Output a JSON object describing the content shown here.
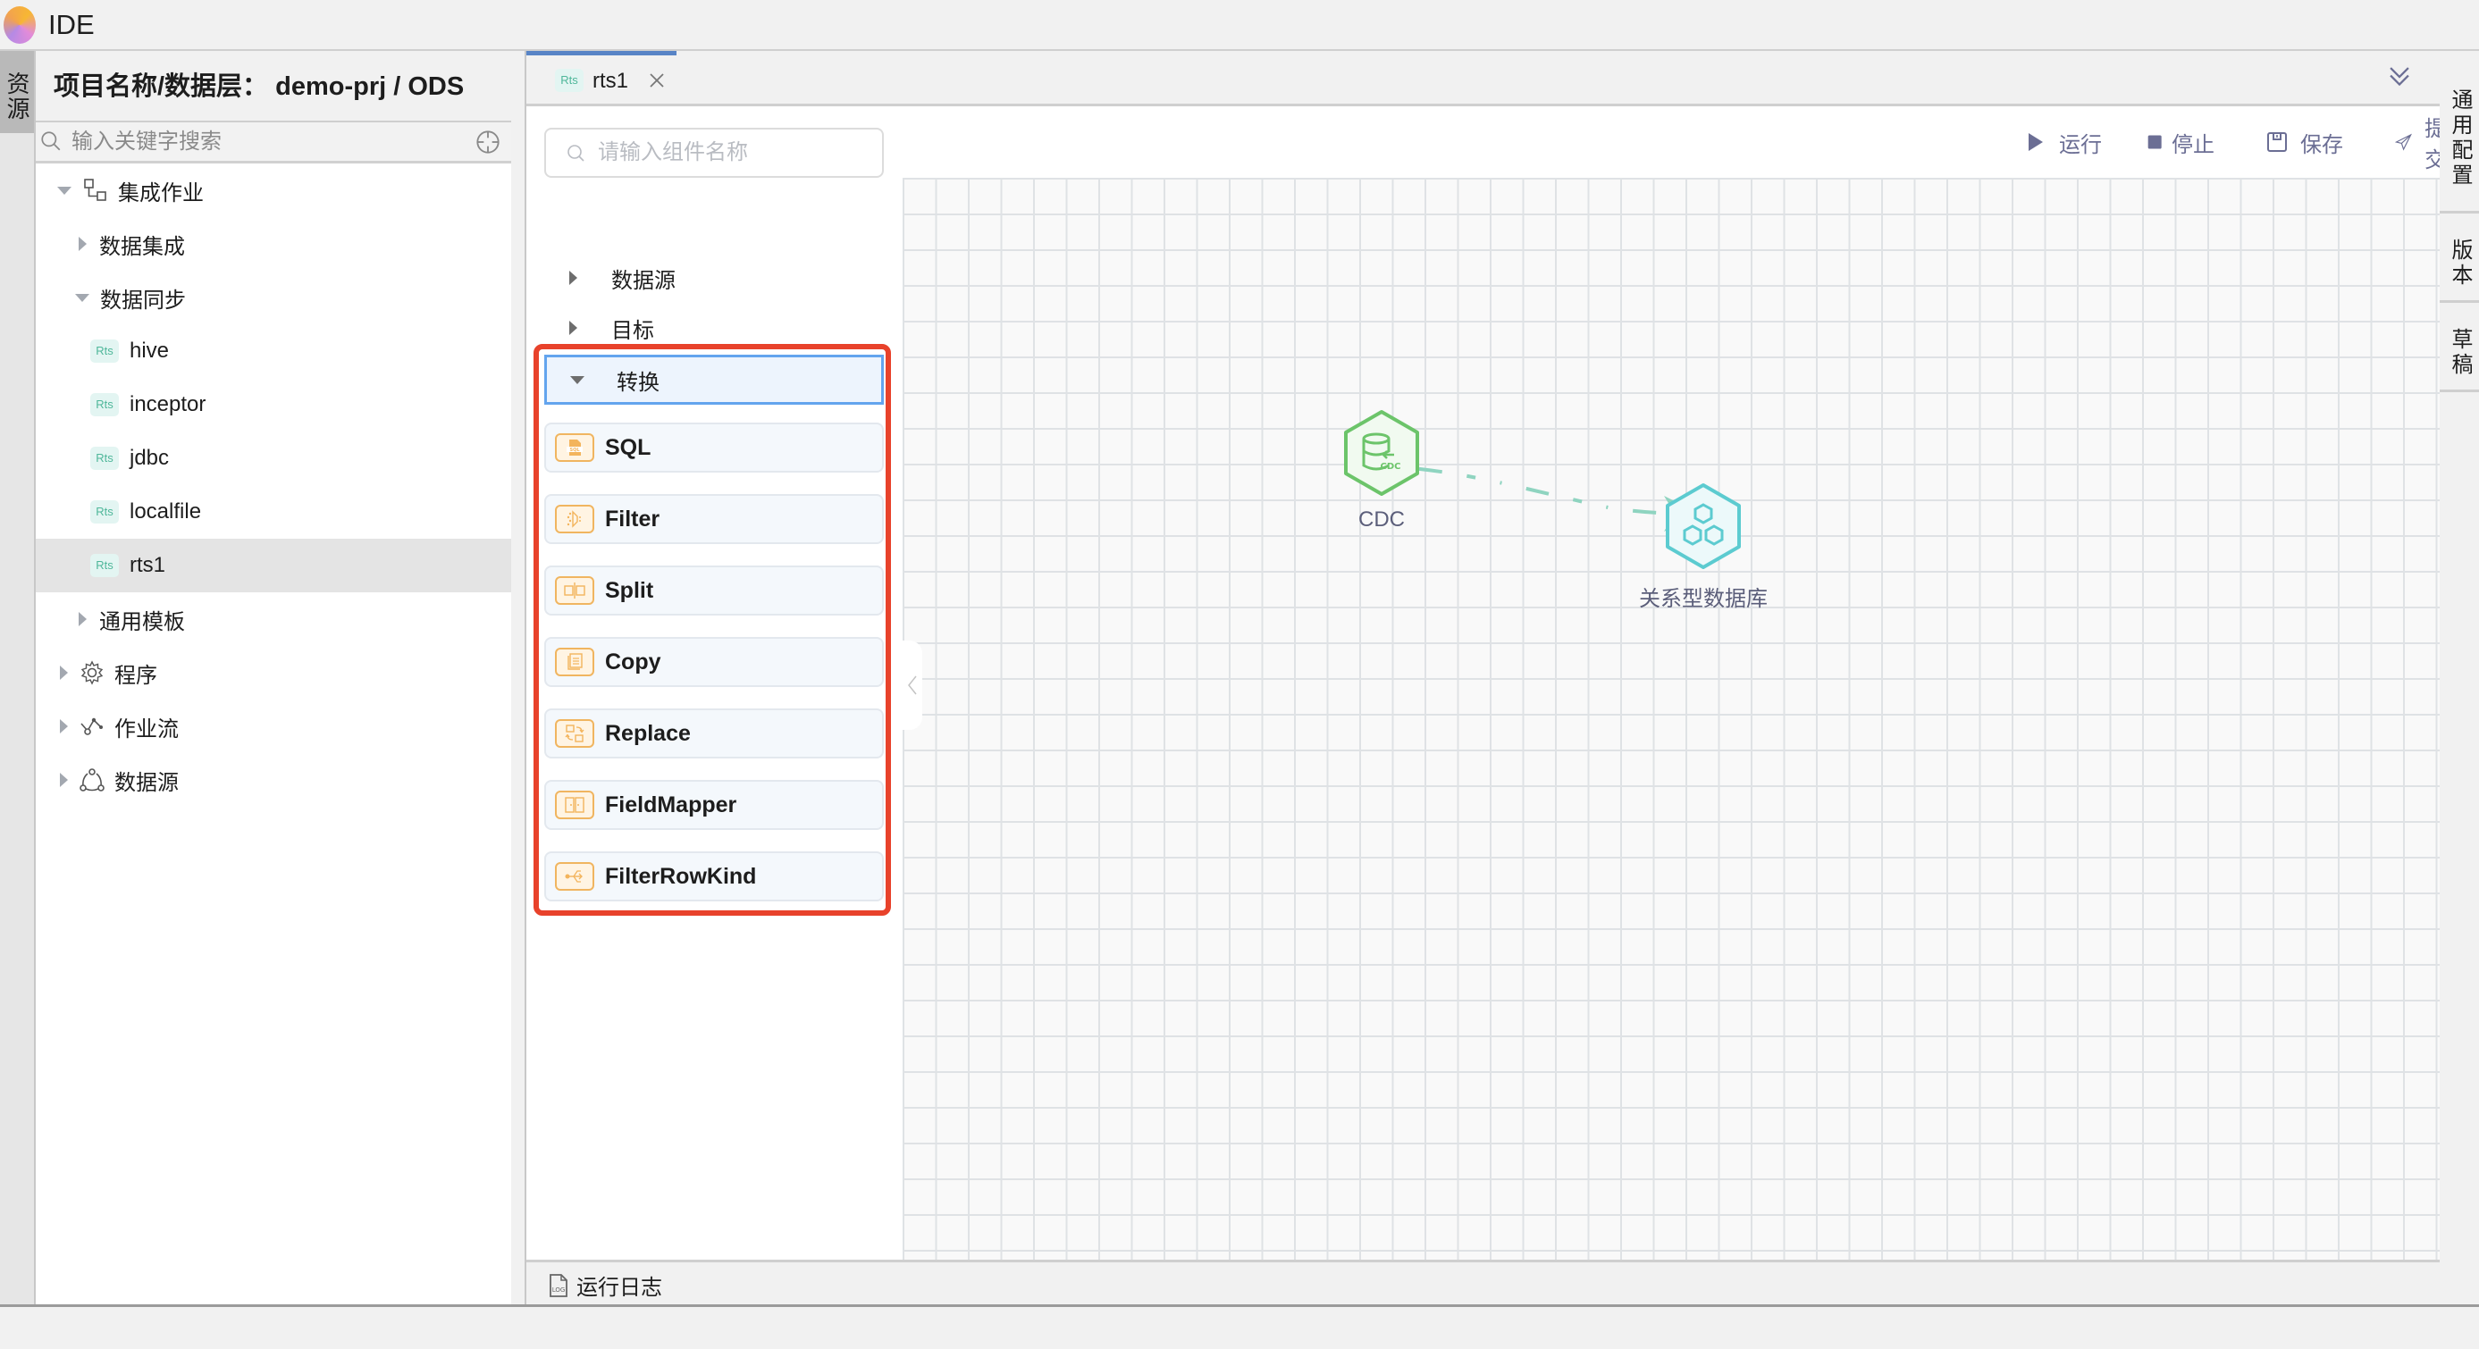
{
  "app": {
    "title": "IDE",
    "logo": "app-logo"
  },
  "left_strip": {
    "tabs": [
      {
        "label": "资源",
        "active": true
      }
    ]
  },
  "left_panel": {
    "header": "项目名称/数据层：  demo-prj / ODS",
    "search": {
      "placeholder": "输入关键字搜索",
      "value": ""
    },
    "tree": [
      {
        "label": "集成作业",
        "icon": "integration-job-icon",
        "expanded": true,
        "level": 0
      },
      {
        "label": "数据集成",
        "expanded": false,
        "level": 1
      },
      {
        "label": "数据同步",
        "expanded": true,
        "level": 1
      },
      {
        "label": "hive",
        "badge": "Rts",
        "level": 2
      },
      {
        "label": "inceptor",
        "badge": "Rts",
        "level": 2
      },
      {
        "label": "jdbc",
        "badge": "Rts",
        "level": 2
      },
      {
        "label": "localfile",
        "badge": "Rts",
        "level": 2
      },
      {
        "label": "rts1",
        "badge": "Rts",
        "level": 2,
        "selected": true
      },
      {
        "label": "通用模板",
        "expanded": false,
        "level": 1
      },
      {
        "label": "程序",
        "icon": "gear-icon",
        "expanded": false,
        "level": 0
      },
      {
        "label": "作业流",
        "icon": "workflow-icon",
        "expanded": false,
        "level": 0
      },
      {
        "label": "数据源",
        "icon": "datasource-icon",
        "expanded": false,
        "level": 0
      }
    ]
  },
  "editor": {
    "tab": {
      "badge": "Rts",
      "label": "rts1"
    },
    "palette": {
      "search_placeholder": "请输入组件名称",
      "groups": [
        {
          "label": "数据源",
          "expanded": false
        },
        {
          "label": "目标",
          "expanded": false
        },
        {
          "label": "转换",
          "expanded": true
        }
      ],
      "components": [
        {
          "label": "SQL",
          "icon": "sql-file-icon"
        },
        {
          "label": "Filter",
          "icon": "filter-icon"
        },
        {
          "label": "Split",
          "icon": "split-icon"
        },
        {
          "label": "Copy",
          "icon": "copy-icon"
        },
        {
          "label": "Replace",
          "icon": "replace-icon"
        },
        {
          "label": "FieldMapper",
          "icon": "field-mapper-icon"
        },
        {
          "label": "FilterRowKind",
          "icon": "filter-rowkind-icon"
        }
      ]
    },
    "toolbar": {
      "run": "运行",
      "stop": "停止",
      "save": "保存",
      "submit": "提交"
    },
    "canvas": {
      "nodes": [
        {
          "id": "cdc",
          "label": "CDC",
          "icon": "cdc-database-icon",
          "color": "#6cc46a"
        },
        {
          "id": "rdb",
          "label": "关系型数据库",
          "icon": "relational-db-icon",
          "color": "#5ccbd0"
        }
      ],
      "edges": [
        {
          "from": "cdc",
          "to": "rdb",
          "style": "dashed",
          "color": "#8fd4c0"
        }
      ]
    },
    "log_bar": {
      "label": "运行日志"
    }
  },
  "right_strip": {
    "tabs": [
      {
        "label": "通用配置"
      },
      {
        "label": "版本"
      },
      {
        "label": "草稿"
      }
    ]
  },
  "colors": {
    "accent": "#5884c6",
    "highlight_box": "#e8422b",
    "toolbar_text": "#6b6e94",
    "component_icon": "#f0b560"
  }
}
